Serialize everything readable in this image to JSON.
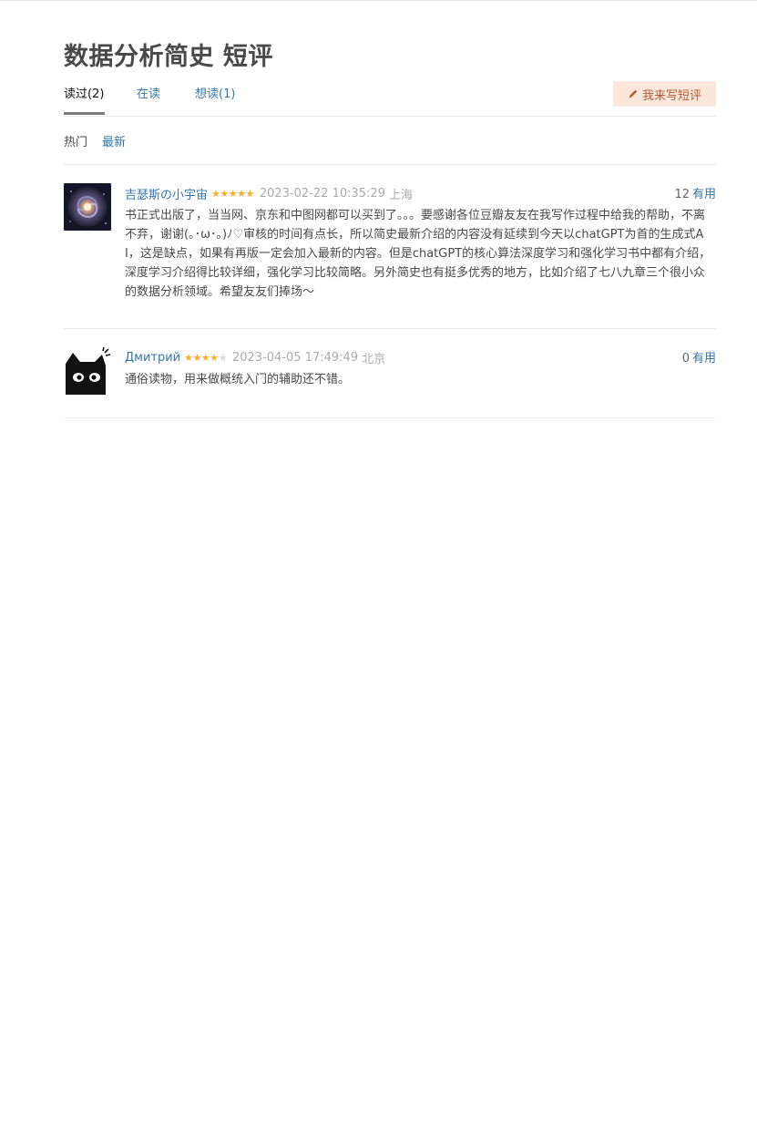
{
  "page": {
    "title": "数据分析简史 短评"
  },
  "tabs": [
    {
      "label": "读过(2)",
      "active": true
    },
    {
      "label": "在读",
      "active": false
    },
    {
      "label": "想读(1)",
      "active": false
    }
  ],
  "write_button": {
    "label": "我来写短评",
    "icon": "pencil-icon"
  },
  "sort": {
    "hot": "热门",
    "latest": "最新"
  },
  "comments": [
    {
      "user": "吉瑟斯の小宇宙",
      "rating": 5,
      "time": "2023-02-22 10:35:29",
      "location": "上海",
      "useful_count": "12",
      "useful_label": "有用",
      "avatar": "galaxy-avatar",
      "text": "书正式出版了，当当网、京东和中图网都可以买到了。。。要感谢各位豆瓣友友在我写作过程中给我的帮助，不离不弃，谢谢(｡･ω･｡)ﾉ♡审核的时间有点长，所以简史最新介绍的内容没有延续到今天以chatGPT为首的生成式AI，这是缺点，如果有再版一定会加入最新的内容。但是chatGPT的核心算法深度学习和强化学习书中都有介绍，深度学习介绍得比较详细，强化学习比较简略。另外简史也有挺多优秀的地方，比如介绍了七八九章三个很小众的数据分析领域。希望友友们捧场～"
    },
    {
      "user": "Дмитрий",
      "rating": 4,
      "time": "2023-04-05 17:49:49",
      "location": "北京",
      "useful_count": "0",
      "useful_label": "有用",
      "avatar": "black-cat-avatar",
      "text": "通俗读物，用来做概统入门的辅助还不错。"
    }
  ],
  "colors": {
    "link": "#3377aa",
    "star": "#ffac2d",
    "button_bg": "#fbe7dc",
    "button_text": "#b35b33"
  }
}
